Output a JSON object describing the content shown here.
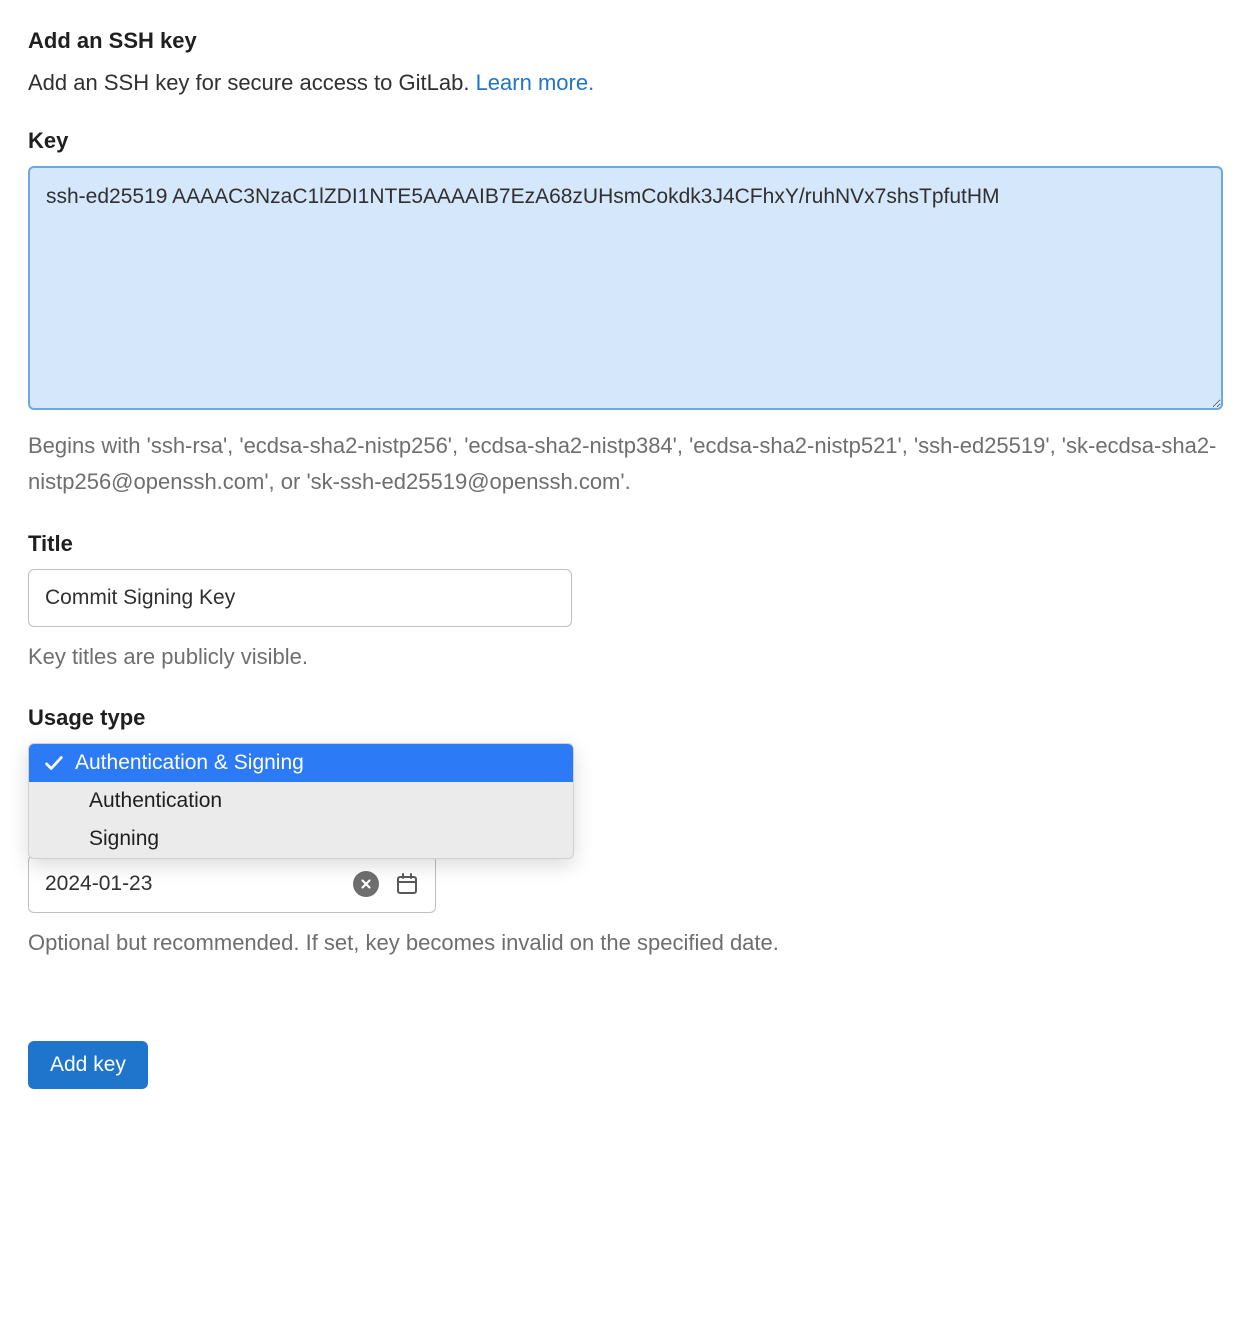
{
  "header": {
    "title": "Add an SSH key",
    "description": "Add an SSH key for secure access to GitLab. ",
    "learn_more": "Learn more."
  },
  "key_field": {
    "label": "Key",
    "value": "ssh-ed25519 AAAAC3NzaC1lZDI1NTE5AAAAIB7EzA68zUHsmCokdk3J4CFhxY/ruhNVx7shsTpfutHM",
    "hint": "Begins with 'ssh-rsa', 'ecdsa-sha2-nistp256', 'ecdsa-sha2-nistp384', 'ecdsa-sha2-nistp521', 'ssh-ed25519', 'sk-ecdsa-sha2-nistp256@openssh.com', or 'sk-ssh-ed25519@openssh.com'."
  },
  "title_field": {
    "label": "Title",
    "value": "Commit Signing Key",
    "hint": "Key titles are publicly visible."
  },
  "usage_type": {
    "label": "Usage type",
    "options": [
      {
        "label": "Authentication & Signing",
        "selected": true
      },
      {
        "label": "Authentication",
        "selected": false
      },
      {
        "label": "Signing",
        "selected": false
      }
    ]
  },
  "expiration": {
    "value": "2024-01-23",
    "hint": "Optional but recommended. If set, key becomes invalid on the specified date."
  },
  "submit": {
    "label": "Add key"
  }
}
